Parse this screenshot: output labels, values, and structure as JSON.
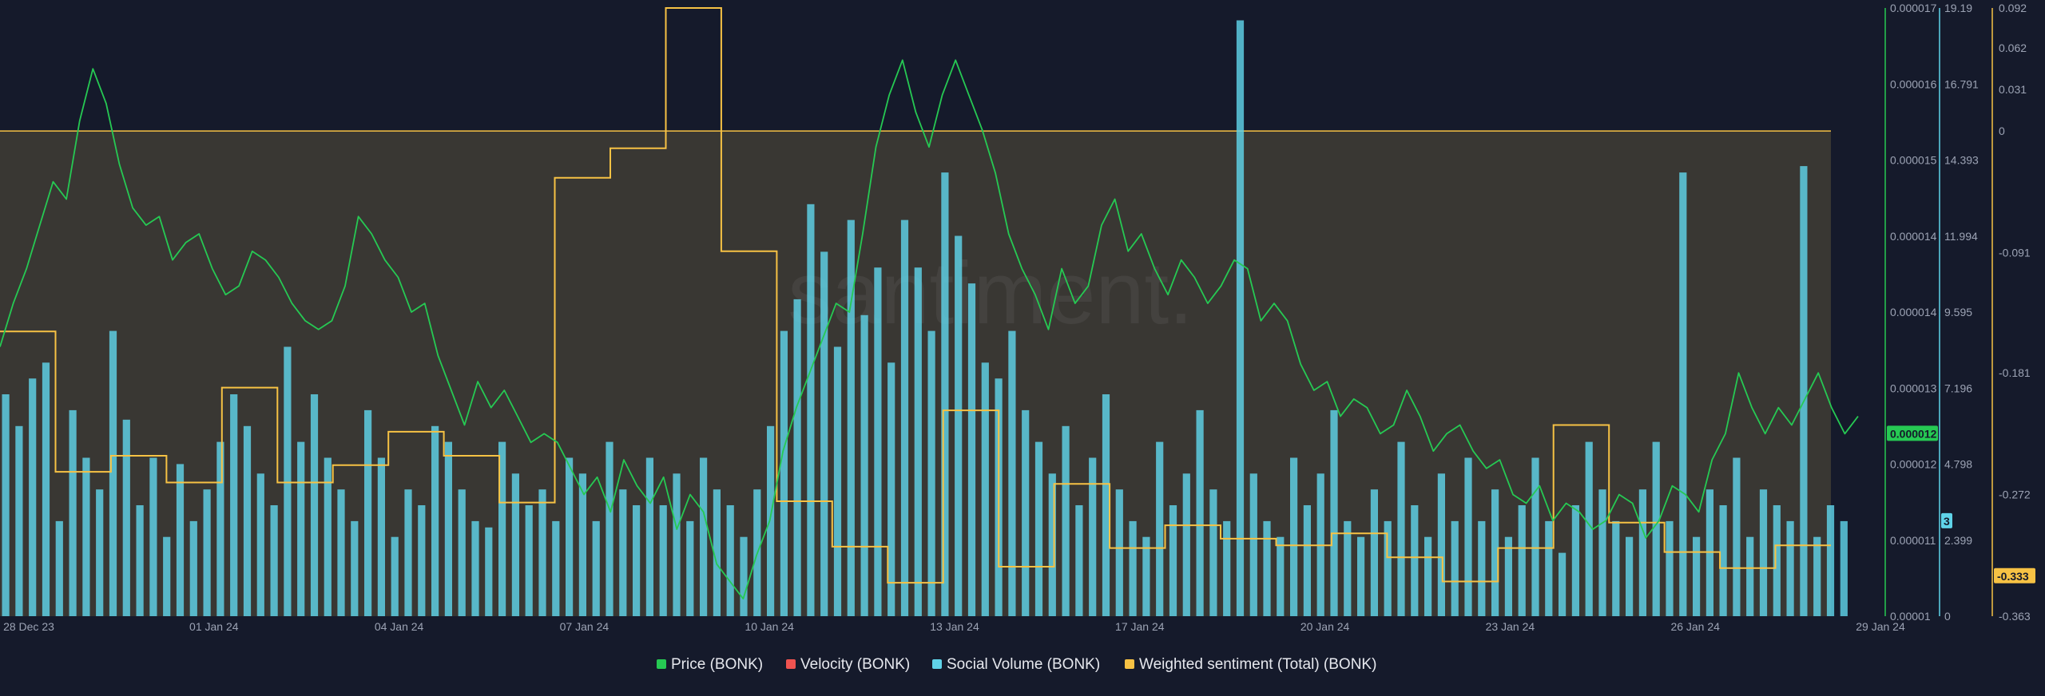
{
  "chart_data": {
    "type": "line",
    "watermark": "santiment.",
    "x_axis": {
      "ticks": [
        "28 Dec 23",
        "01 Jan 24",
        "04 Jan 24",
        "07 Jan 24",
        "10 Jan 24",
        "13 Jan 24",
        "17 Jan 24",
        "20 Jan 24",
        "23 Jan 24",
        "26 Jan 24",
        "29 Jan 24"
      ]
    },
    "axes": {
      "price": {
        "color": "#26c953",
        "ticks": [
          "0.000017",
          "0.000016",
          "0.000015",
          "0.000014",
          "0.000014",
          "0.000013",
          "0.000012",
          "0.000011",
          "0.00001"
        ],
        "current_value": "0.000012"
      },
      "social_volume": {
        "color": "#5fd3e9",
        "ticks": [
          "19.19",
          "16.791",
          "14.393",
          "11.994",
          "9.595",
          "7.196",
          "4.798",
          "2.399",
          "0"
        ],
        "range": [
          0,
          19.19
        ],
        "current_value": "3"
      },
      "sentiment": {
        "color": "#f7c244",
        "ticks": [
          "0.092",
          "0.062",
          "0.031",
          "0",
          "-0.091",
          "-0.181",
          "-0.272",
          "-0.363"
        ],
        "range": [
          -0.363,
          0.092
        ],
        "current_value": "-0.333"
      }
    },
    "series": [
      {
        "name": "Price (BONK)",
        "color": "#26c953",
        "key": "price"
      },
      {
        "name": "Velocity (BONK)",
        "color": "#ef5350",
        "key": "velocity"
      },
      {
        "name": "Social Volume (BONK)",
        "color": "#5fd3e9",
        "key": "social_volume"
      },
      {
        "name": "Weighted sentiment (Total) (BONK)",
        "color": "#f7c244",
        "key": "sentiment"
      }
    ],
    "price_values": [
      1.31e-05,
      1.36e-05,
      1.4e-05,
      1.45e-05,
      1.5e-05,
      1.48e-05,
      1.57e-05,
      1.63e-05,
      1.59e-05,
      1.52e-05,
      1.47e-05,
      1.45e-05,
      1.46e-05,
      1.41e-05,
      1.43e-05,
      1.44e-05,
      1.4e-05,
      1.37e-05,
      1.38e-05,
      1.42e-05,
      1.41e-05,
      1.39e-05,
      1.36e-05,
      1.34e-05,
      1.33e-05,
      1.34e-05,
      1.38e-05,
      1.46e-05,
      1.44e-05,
      1.41e-05,
      1.39e-05,
      1.35e-05,
      1.36e-05,
      1.3e-05,
      1.26e-05,
      1.22e-05,
      1.27e-05,
      1.24e-05,
      1.26e-05,
      1.23e-05,
      1.2e-05,
      1.21e-05,
      1.2e-05,
      1.17e-05,
      1.14e-05,
      1.16e-05,
      1.12e-05,
      1.18e-05,
      1.15e-05,
      1.13e-05,
      1.16e-05,
      1.1e-05,
      1.14e-05,
      1.12e-05,
      1.06e-05,
      1.04e-05,
      1.02e-05,
      1.07e-05,
      1.11e-05,
      1.19e-05,
      1.24e-05,
      1.28e-05,
      1.32e-05,
      1.36e-05,
      1.35e-05,
      1.44e-05,
      1.54e-05,
      1.6e-05,
      1.64e-05,
      1.58e-05,
      1.54e-05,
      1.6e-05,
      1.64e-05,
      1.6e-05,
      1.56e-05,
      1.51e-05,
      1.44e-05,
      1.4e-05,
      1.37e-05,
      1.33e-05,
      1.4e-05,
      1.36e-05,
      1.38e-05,
      1.45e-05,
      1.48e-05,
      1.42e-05,
      1.44e-05,
      1.4e-05,
      1.37e-05,
      1.41e-05,
      1.39e-05,
      1.36e-05,
      1.38e-05,
      1.41e-05,
      1.4e-05,
      1.34e-05,
      1.36e-05,
      1.34e-05,
      1.29e-05,
      1.26e-05,
      1.27e-05,
      1.23e-05,
      1.25e-05,
      1.24e-05,
      1.21e-05,
      1.22e-05,
      1.26e-05,
      1.23e-05,
      1.19e-05,
      1.21e-05,
      1.22e-05,
      1.19e-05,
      1.17e-05,
      1.18e-05,
      1.14e-05,
      1.13e-05,
      1.15e-05,
      1.11e-05,
      1.13e-05,
      1.12e-05,
      1.1e-05,
      1.11e-05,
      1.14e-05,
      1.13e-05,
      1.09e-05,
      1.11e-05,
      1.15e-05,
      1.14e-05,
      1.12e-05,
      1.18e-05,
      1.21e-05,
      1.28e-05,
      1.24e-05,
      1.21e-05,
      1.24e-05,
      1.22e-05,
      1.25e-05,
      1.28e-05,
      1.24e-05,
      1.21e-05,
      1.23e-05
    ],
    "social_volume_values": [
      7.0,
      6.0,
      7.5,
      8.0,
      3.0,
      6.5,
      5.0,
      4.0,
      9.0,
      6.2,
      3.5,
      5.0,
      2.5,
      4.8,
      3.0,
      4.0,
      5.5,
      7.0,
      6.0,
      4.5,
      3.5,
      8.5,
      5.5,
      7.0,
      5.0,
      4.0,
      3.0,
      6.5,
      5.0,
      2.5,
      4.0,
      3.5,
      6.0,
      5.5,
      4.0,
      3.0,
      2.8,
      5.5,
      4.5,
      3.5,
      4.0,
      3.0,
      5.0,
      4.5,
      3.0,
      5.5,
      4.0,
      3.5,
      5.0,
      3.5,
      4.5,
      3.0,
      5.0,
      4.0,
      3.5,
      2.5,
      4.0,
      6.0,
      9.0,
      10.0,
      13.0,
      11.5,
      8.5,
      12.5,
      9.5,
      11.0,
      8.0,
      12.5,
      11.0,
      9.0,
      14.0,
      12.0,
      10.5,
      8.0,
      7.5,
      9.0,
      6.5,
      5.5,
      4.5,
      6.0,
      3.5,
      5.0,
      7.0,
      4.0,
      3.0,
      2.5,
      5.5,
      3.5,
      4.5,
      6.5,
      4.0,
      3.0,
      18.8,
      4.5,
      3.0,
      2.5,
      5.0,
      3.5,
      4.5,
      6.5,
      3.0,
      2.5,
      4.0,
      3.0,
      5.5,
      3.5,
      2.5,
      4.5,
      3.0,
      5.0,
      3.0,
      4.0,
      2.5,
      3.5,
      5.0,
      3.0,
      2.0,
      3.5,
      5.5,
      4.0,
      3.0,
      2.5,
      4.0,
      5.5,
      3.0,
      14.0,
      2.5,
      4.0,
      3.5,
      5.0,
      2.5,
      4.0,
      3.5,
      3.0,
      14.2,
      2.5,
      3.5,
      3.0
    ],
    "sentiment_values": [
      -0.15,
      -0.15,
      -0.255,
      -0.255,
      -0.243,
      -0.243,
      -0.263,
      -0.263,
      -0.192,
      -0.192,
      -0.263,
      -0.263,
      -0.25,
      -0.25,
      -0.225,
      -0.225,
      -0.243,
      -0.243,
      -0.278,
      -0.278,
      -0.035,
      -0.035,
      -0.013,
      -0.013,
      0.092,
      0.092,
      -0.09,
      -0.09,
      -0.277,
      -0.277,
      -0.311,
      -0.311,
      -0.338,
      -0.338,
      -0.209,
      -0.209,
      -0.326,
      -0.326,
      -0.264,
      -0.264,
      -0.312,
      -0.312,
      -0.295,
      -0.295,
      -0.305,
      -0.305,
      -0.31,
      -0.31,
      -0.301,
      -0.301,
      -0.319,
      -0.319,
      -0.337,
      -0.337,
      -0.312,
      -0.312,
      -0.22,
      -0.22,
      -0.293,
      -0.293,
      -0.315,
      -0.315,
      -0.327,
      -0.327,
      -0.31,
      -0.31
    ],
    "sentiment_band_top": 0
  }
}
